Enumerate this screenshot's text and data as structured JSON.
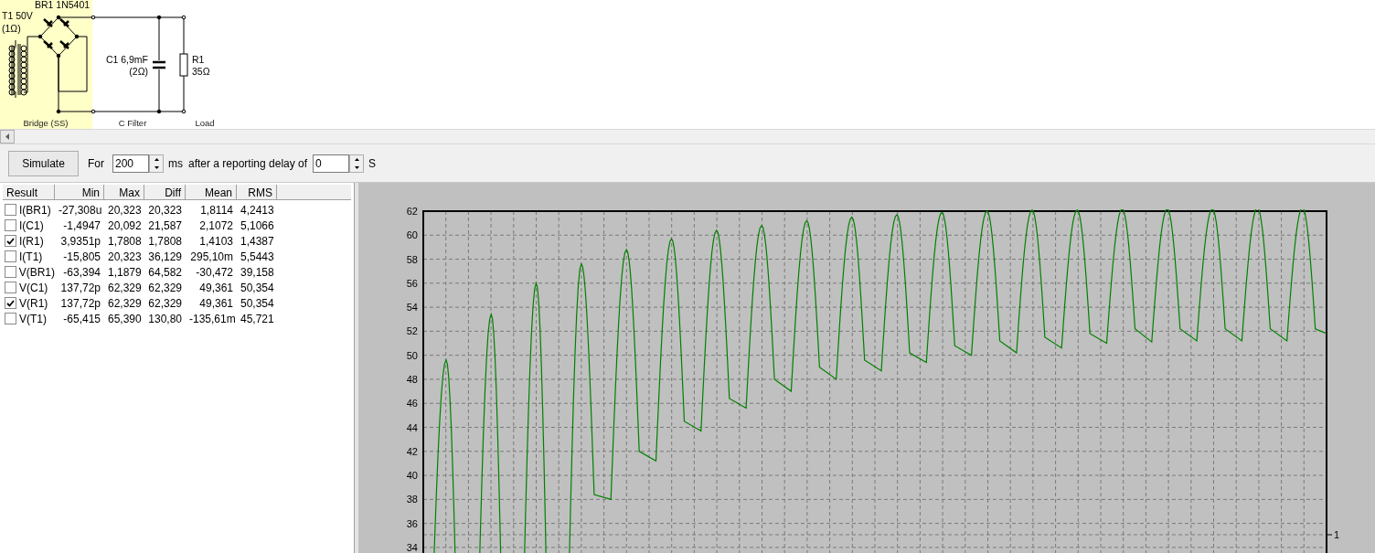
{
  "schematic": {
    "labels": [
      {
        "kind": "part",
        "text": "BR1 1N5401"
      },
      {
        "kind": "part",
        "text": "T1 50V"
      },
      {
        "kind": "part",
        "text": "(1Ω)"
      },
      {
        "kind": "part",
        "text": "C1 6,9mF"
      },
      {
        "kind": "part",
        "text": "(2Ω)"
      },
      {
        "kind": "part",
        "text": "R1"
      },
      {
        "kind": "part",
        "text": "35Ω"
      },
      {
        "kind": "section",
        "text": "Bridge (SS)"
      },
      {
        "kind": "section",
        "text": "C Filter"
      },
      {
        "kind": "section",
        "text": "Load"
      }
    ]
  },
  "toolbar": {
    "simulate": "Simulate",
    "for_label": "For",
    "duration": "200",
    "duration_unit": "ms",
    "delay_label": "after a reporting delay of",
    "delay": "0",
    "delay_unit": "S"
  },
  "results": {
    "columns": [
      "Result",
      "Min",
      "Max",
      "Diff",
      "Mean",
      "RMS"
    ],
    "rows": [
      {
        "name": "I(BR1)",
        "checked": false,
        "values": [
          "-27,308u",
          "20,323",
          "20,323",
          "1,8114",
          "4,2413"
        ]
      },
      {
        "name": "I(C1)",
        "checked": false,
        "values": [
          "-1,4947",
          "20,092",
          "21,587",
          "2,1072",
          "5,1066"
        ]
      },
      {
        "name": "I(R1)",
        "checked": true,
        "values": [
          "3,9351p",
          "1,7808",
          "1,7808",
          "1,4103",
          "1,4387"
        ]
      },
      {
        "name": "I(T1)",
        "checked": false,
        "values": [
          "-15,805",
          "20,323",
          "36,129",
          "295,10m",
          "5,5443"
        ]
      },
      {
        "name": "V(BR1)",
        "checked": false,
        "values": [
          "-63,394",
          "1,1879",
          "64,582",
          "-30,472",
          "39,158"
        ]
      },
      {
        "name": "V(C1)",
        "checked": false,
        "values": [
          "137,72p",
          "62,329",
          "62,329",
          "49,361",
          "50,354"
        ]
      },
      {
        "name": "V(R1)",
        "checked": true,
        "values": [
          "137,72p",
          "62,329",
          "62,329",
          "49,361",
          "50,354"
        ]
      },
      {
        "name": "V(T1)",
        "checked": false,
        "values": [
          "-65,415",
          "65,390",
          "130,80",
          "-135,61m",
          "45,721"
        ]
      }
    ]
  },
  "graph": {
    "y_ticks": [
      "62",
      "60",
      "58",
      "56",
      "54",
      "52",
      "50",
      "48",
      "46",
      "44",
      "42",
      "40",
      "38",
      "36",
      "34"
    ],
    "trace_label": "1"
  }
}
